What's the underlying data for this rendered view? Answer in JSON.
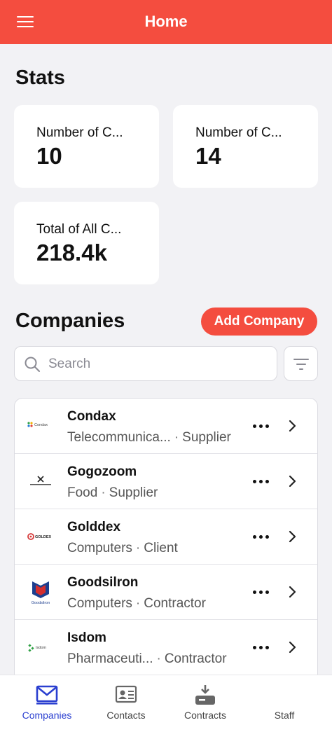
{
  "header": {
    "title": "Home",
    "menu_icon": "hamburger-icon"
  },
  "stats": {
    "title": "Stats",
    "cards": [
      {
        "label": "Number of C...",
        "value": "10"
      },
      {
        "label": "Number of C...",
        "value": "14"
      },
      {
        "label": "Total of All C...",
        "value": "218.4k"
      }
    ]
  },
  "companies": {
    "title": "Companies",
    "add_label": "Add Company",
    "search_placeholder": "Search",
    "search_value": "",
    "items": [
      {
        "name": "Condax",
        "category": "Telecommunica...",
        "role": "Supplier",
        "logo_text": "Condax"
      },
      {
        "name": "Gogozoom",
        "category": "Food",
        "role": "Supplier",
        "logo_text": ""
      },
      {
        "name": "Golddex",
        "category": "Computers",
        "role": "Client",
        "logo_text": "GOLDEX"
      },
      {
        "name": "Goodsilron",
        "category": "Computers",
        "role": "Contractor",
        "logo_text": "Goodsilron"
      },
      {
        "name": "Isdom",
        "category": "Pharmaceuti...",
        "role": "Contractor",
        "logo_text": "Isdom"
      }
    ]
  },
  "bottom_nav": [
    {
      "label": "Companies",
      "icon": "envelope-icon",
      "active": true
    },
    {
      "label": "Contacts",
      "icon": "contact-card-icon",
      "active": false
    },
    {
      "label": "Contracts",
      "icon": "contract-download-icon",
      "active": false
    },
    {
      "label": "Staff",
      "icon": "staff-icon",
      "active": false
    }
  ],
  "colors": {
    "accent": "#f44d3f",
    "active_nav": "#2a3fd0",
    "background": "#f2f2f5"
  }
}
